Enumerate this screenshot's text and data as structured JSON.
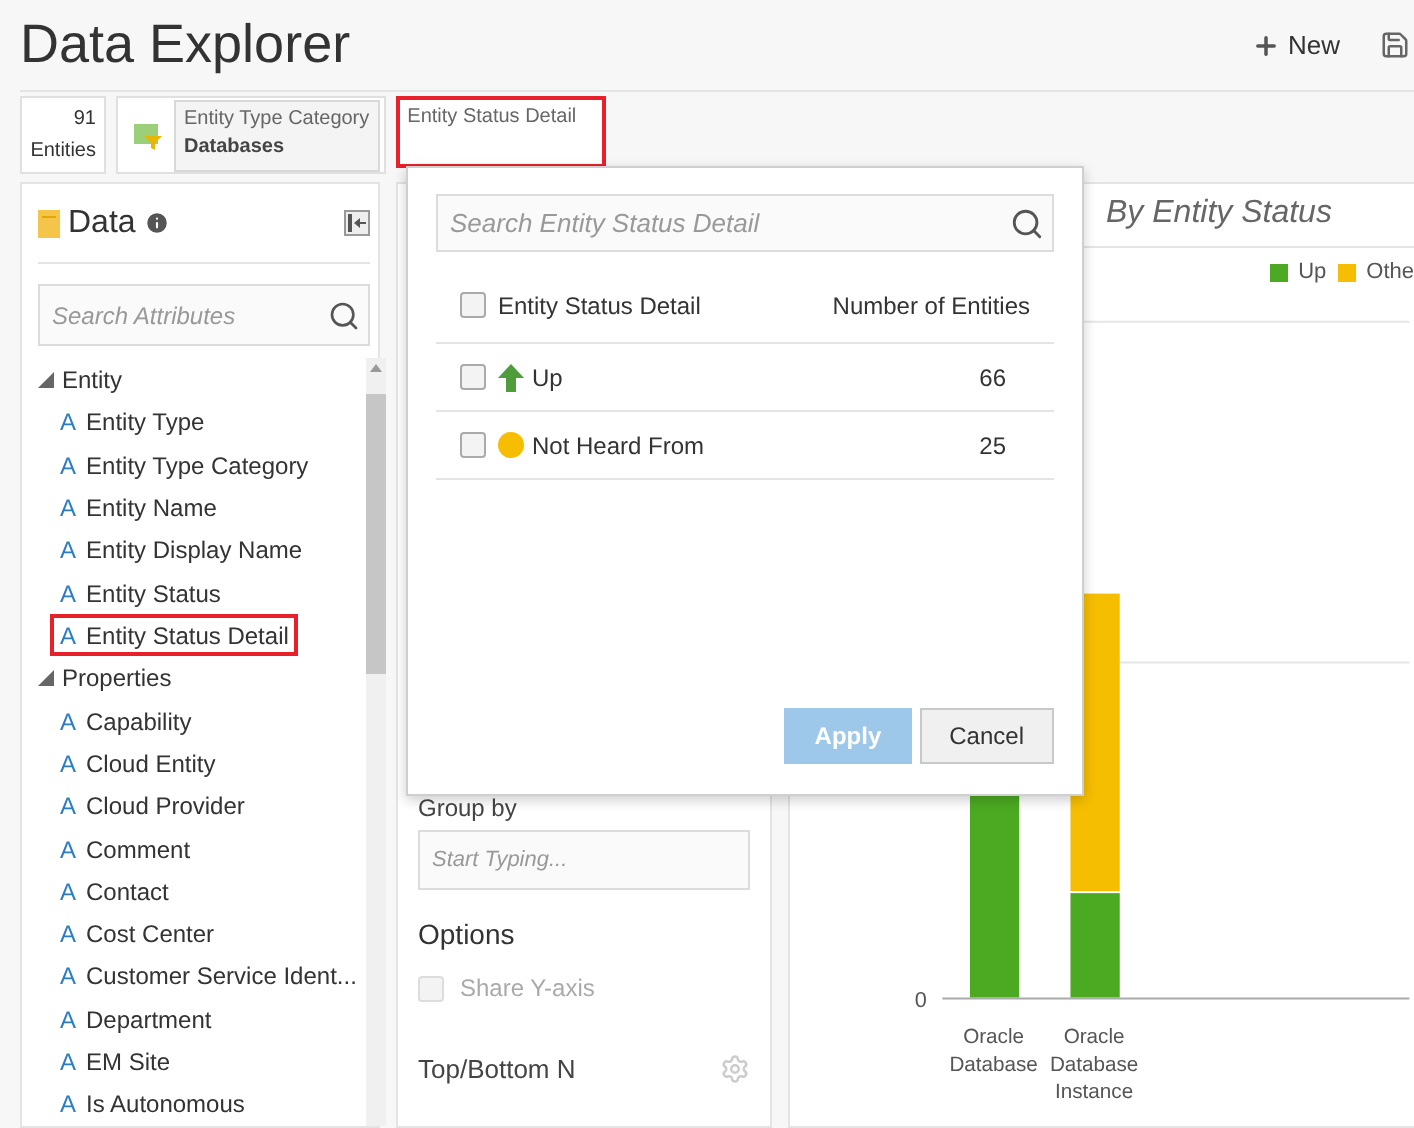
{
  "header": {
    "title": "Data Explorer",
    "new_label": "New"
  },
  "summary": {
    "count": "91",
    "unit": "Entities"
  },
  "filters": [
    {
      "label": "Entity Type Category",
      "value": "Databases",
      "highlighted": false
    },
    {
      "label": "Entity Status Detail",
      "highlighted": true
    }
  ],
  "data_panel": {
    "title": "Data",
    "search": {
      "placeholder": "Search Attributes"
    },
    "tree": [
      {
        "label": "Entity",
        "expanded": true,
        "children": [
          {
            "glyph": "A",
            "label": "Entity Type",
            "selected": false
          },
          {
            "glyph": "A",
            "label": "Entity Type Category",
            "selected": false
          },
          {
            "glyph": "A",
            "label": "Entity Name",
            "selected": false
          },
          {
            "glyph": "A",
            "label": "Entity Display Name",
            "selected": false
          },
          {
            "glyph": "A",
            "label": "Entity Status",
            "selected": false
          },
          {
            "glyph": "A",
            "label": "Entity Status Detail",
            "selected": true
          }
        ]
      },
      {
        "label": "Properties",
        "expanded": true,
        "children": [
          {
            "glyph": "A",
            "label": "Capability",
            "selected": false
          },
          {
            "glyph": "A",
            "label": "Cloud Entity",
            "selected": false
          },
          {
            "glyph": "A",
            "label": "Cloud Provider",
            "selected": false
          },
          {
            "glyph": "A",
            "label": "Comment",
            "selected": false
          },
          {
            "glyph": "A",
            "label": "Contact",
            "selected": false
          },
          {
            "glyph": "A",
            "label": "Cost Center",
            "selected": false
          },
          {
            "glyph": "A",
            "label": "Customer Service Ident...",
            "selected": false
          },
          {
            "glyph": "A",
            "label": "Department",
            "selected": false
          },
          {
            "glyph": "A",
            "label": "EM Site",
            "selected": false
          },
          {
            "glyph": "A",
            "label": "Is Autonomous",
            "selected": false
          }
        ]
      }
    ]
  },
  "middle_panel": {
    "group_by": {
      "label": "Group by",
      "placeholder": "Start Typing..."
    },
    "options": {
      "title": "Options",
      "share_y_axis": {
        "label": "Share Y-axis",
        "checked": false,
        "disabled": true
      }
    },
    "top_bottom": {
      "label": "Top/Bottom N"
    }
  },
  "chart": {
    "title": "By Entity Status",
    "legend": [
      {
        "label": "Up",
        "color": "#4caa22"
      },
      {
        "label": "Othe",
        "color": "#f6be00"
      }
    ],
    "y_tick": "0",
    "categories": [
      [
        "Oracle",
        "Database"
      ],
      [
        "Oracle",
        "Database",
        "Instance"
      ]
    ]
  },
  "popup": {
    "search": {
      "placeholder": "Search Entity Status Detail"
    },
    "columns": [
      "Entity Status Detail",
      "Number of Entities"
    ],
    "header_checked": false,
    "rows": [
      {
        "kind": "up",
        "label": "Up",
        "count": "66",
        "checked": false
      },
      {
        "kind": "not_heard",
        "label": "Not Heard From",
        "count": "25",
        "checked": false
      }
    ],
    "buttons": [
      {
        "label": "Apply",
        "kind": "primary",
        "disabled": true
      },
      {
        "label": "Cancel",
        "kind": "secondary",
        "disabled": false
      }
    ]
  }
}
